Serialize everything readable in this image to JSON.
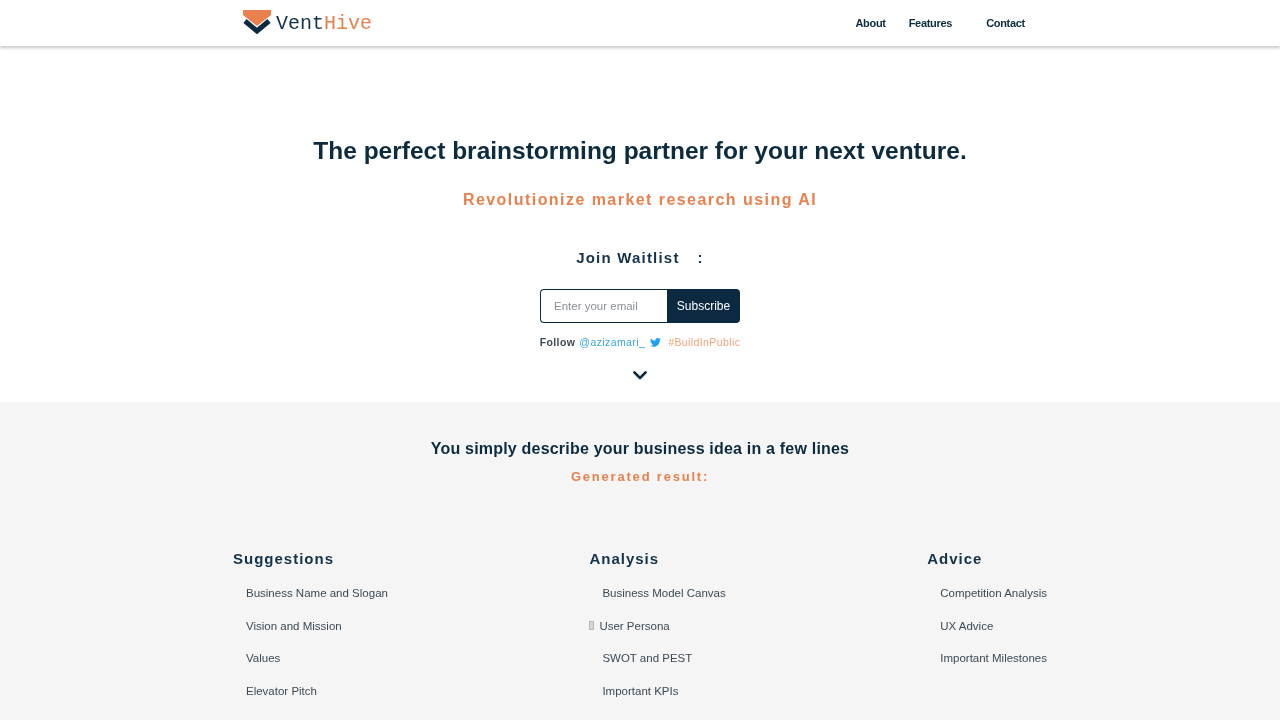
{
  "header": {
    "logo": {
      "parts": [
        "Vent",
        "Hive"
      ]
    },
    "nav": [
      "About",
      "Features",
      "Contact"
    ]
  },
  "hero": {
    "title": "The perfect brainstorming partner for your next venture.",
    "subtitle": "Revolutionize market research using AI",
    "waitlist": {
      "label": "Join Waitlist",
      "separator": ":",
      "email": {
        "placeholder": "Enter your email"
      },
      "button": "Subscribe"
    },
    "follow": {
      "label": "Follow",
      "handle": "@azizamari_",
      "hashtag": "#BuildInPublic"
    }
  },
  "features": {
    "intro": "You simply describe your business idea in a few lines",
    "result_label": "Generated result:",
    "columns": [
      {
        "title": "Suggestions",
        "items": [
          {
            "label": "Business Name and Slogan",
            "kind": "plain"
          },
          {
            "label": "Vision and Mission",
            "kind": "plain"
          },
          {
            "label": "Values",
            "kind": "plain"
          },
          {
            "label": "Elevator Pitch",
            "kind": "plain"
          }
        ]
      },
      {
        "title": "Analysis",
        "items": [
          {
            "label": "Business Model Canvas",
            "kind": "plain"
          },
          {
            "label": "User Persona",
            "kind": "glyph"
          },
          {
            "label": "SWOT and PEST",
            "kind": "plain"
          },
          {
            "label": "Important KPIs",
            "kind": "plain"
          }
        ]
      },
      {
        "title": "Advice",
        "items": [
          {
            "label": "Competition Analysis",
            "kind": "plain"
          },
          {
            "label": "UX Advice",
            "kind": "plain"
          },
          {
            "label": "Important Milestones",
            "kind": "plain"
          }
        ]
      }
    ]
  }
}
